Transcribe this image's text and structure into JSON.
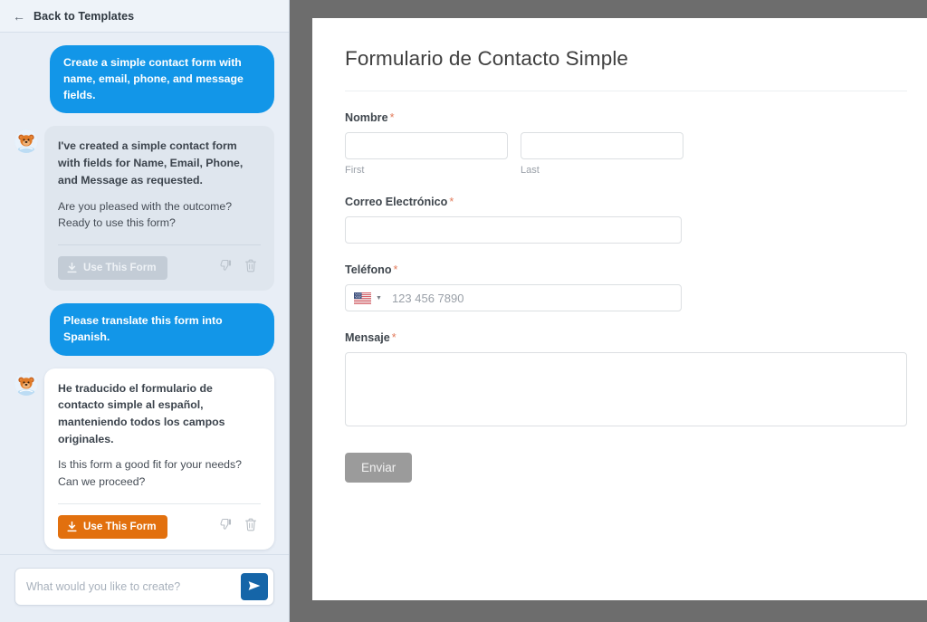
{
  "sidebar": {
    "back_button": {
      "label": "Back to Templates",
      "icon": "arrow-left-icon"
    },
    "messages": [
      {
        "role": "user",
        "text": "Create a simple contact form with name, email, phone, and message fields."
      },
      {
        "role": "assistant",
        "avatar_icon": "bear-mascot-avatar",
        "paragraph1": "I've created a simple contact form with fields for Name, Email, Phone, and Message as requested.",
        "paragraph2": "Are you pleased with the outcome? Ready to use this form?",
        "use_form_label": "Use This Form",
        "use_form_state": "disabled",
        "thumbs_down_icon": "thumbs-down-icon",
        "delete_icon": "trash-icon"
      },
      {
        "role": "user",
        "text": "Please translate this form into Spanish."
      },
      {
        "role": "assistant",
        "avatar_icon": "bear-mascot-avatar",
        "paragraph1": "He traducido el formulario de contacto simple al español, manteniendo todos los campos originales.",
        "paragraph2": "Is this form a good fit for your needs? Can we proceed?",
        "use_form_label": "Use This Form",
        "use_form_state": "enabled",
        "thumbs_down_icon": "thumbs-down-icon",
        "delete_icon": "trash-icon"
      }
    ],
    "composer": {
      "placeholder": "What would you like to create?",
      "value": "",
      "send_icon": "send-paper-plane-icon"
    }
  },
  "form": {
    "title": "Formulario de Contacto Simple",
    "required_marker": "*",
    "fields": {
      "name": {
        "label": "Nombre",
        "required": true,
        "first": {
          "sub_label": "First",
          "value": "",
          "placeholder": ""
        },
        "last": {
          "sub_label": "Last",
          "value": "",
          "placeholder": ""
        }
      },
      "email": {
        "label": "Correo Electrónico",
        "required": true,
        "value": "",
        "placeholder": ""
      },
      "phone": {
        "label": "Teléfono",
        "required": true,
        "value": "",
        "placeholder": "123 456 7890",
        "country_flag": "us-flag-icon",
        "caret_icon": "chevron-down-icon"
      },
      "message": {
        "label": "Mensaje",
        "required": true,
        "value": "",
        "placeholder": ""
      }
    },
    "submit_label": "Enviar"
  },
  "colors": {
    "user_bubble": "#1296e8",
    "assistant_bubble_muted": "#dfe6ee",
    "assistant_bubble_active": "#ffffff",
    "use_form_enabled": "#e2700e",
    "use_form_disabled": "#c3ccd6",
    "send_button": "#1565a8",
    "submit_button": "#9b9b9b",
    "required_marker": "#e27a5a",
    "sidebar_background": "#e8eef6",
    "preview_backdrop": "#6d6d6d"
  }
}
